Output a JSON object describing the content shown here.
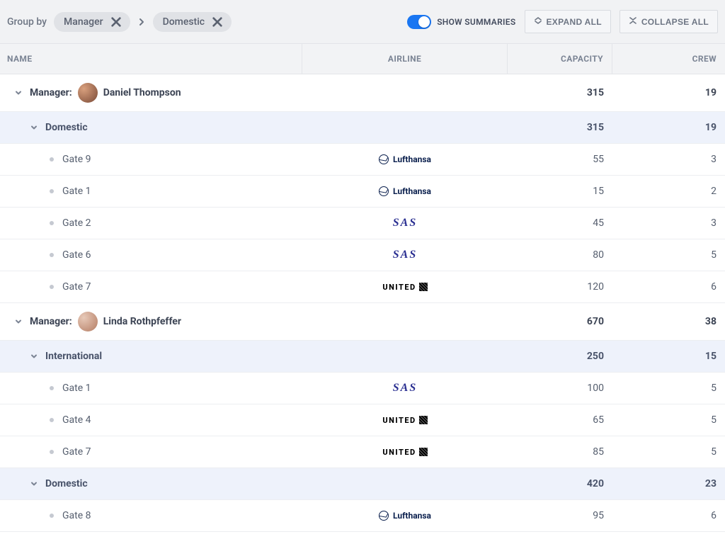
{
  "toolbar": {
    "group_by_label": "Group by",
    "chips": [
      "Manager",
      "Domestic"
    ],
    "show_summaries_label": "Show Summaries",
    "show_summaries_on": true,
    "expand_all": "Expand All",
    "collapse_all": "Collapse All"
  },
  "columns": {
    "name": "Name",
    "airline": "Airline",
    "capacity": "Capacity",
    "crew": "Crew"
  },
  "group_field_label": "Manager:",
  "groups": [
    {
      "manager": "Daniel Thompson",
      "avatar_class": "av1",
      "capacity": 315,
      "crew": 19,
      "subgroups": [
        {
          "label": "Domestic",
          "capacity": 315,
          "crew": 19,
          "rows": [
            {
              "gate": "Gate 9",
              "airline": "lufthansa",
              "capacity": 55,
              "crew": 3
            },
            {
              "gate": "Gate 1",
              "airline": "lufthansa",
              "capacity": 15,
              "crew": 2
            },
            {
              "gate": "Gate 2",
              "airline": "sas",
              "capacity": 45,
              "crew": 3
            },
            {
              "gate": "Gate 6",
              "airline": "sas",
              "capacity": 80,
              "crew": 5
            },
            {
              "gate": "Gate 7",
              "airline": "united",
              "capacity": 120,
              "crew": 6
            }
          ]
        }
      ]
    },
    {
      "manager": "Linda Rothpfeffer",
      "avatar_class": "av2",
      "capacity": 670,
      "crew": 38,
      "subgroups": [
        {
          "label": "International",
          "capacity": 250,
          "crew": 15,
          "rows": [
            {
              "gate": "Gate 1",
              "airline": "sas",
              "capacity": 100,
              "crew": 5
            },
            {
              "gate": "Gate 4",
              "airline": "united",
              "capacity": 65,
              "crew": 5
            },
            {
              "gate": "Gate 7",
              "airline": "united",
              "capacity": 85,
              "crew": 5
            }
          ]
        },
        {
          "label": "Domestic",
          "capacity": 420,
          "crew": 23,
          "rows": [
            {
              "gate": "Gate 8",
              "airline": "lufthansa",
              "capacity": 95,
              "crew": 6
            }
          ]
        }
      ]
    }
  ],
  "airline_labels": {
    "lufthansa": "Lufthansa",
    "sas": "SAS",
    "united": "UNITED"
  }
}
